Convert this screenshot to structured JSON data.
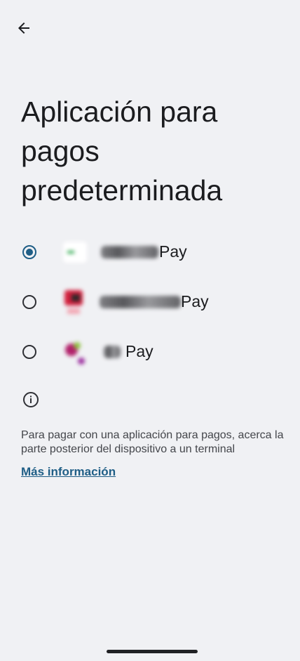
{
  "title": "Aplicación para pagos predeterminada",
  "apps": [
    {
      "pay_label": "Pay",
      "selected": true,
      "icon_colors": [
        "#ffffff",
        "#2fa84f"
      ]
    },
    {
      "pay_label": "Pay",
      "selected": false,
      "icon_colors": [
        "#d21f3c",
        "#f2a7b3"
      ]
    },
    {
      "pay_label": "Pay",
      "selected": false,
      "icon_colors": [
        "#b1206a",
        "#8bbf3a"
      ]
    }
  ],
  "footer": {
    "description": "Para pagar con una aplicación para pagos, acerca la parte posterior del dispositivo a un terminal",
    "link": "Más información"
  },
  "colors": {
    "accent": "#1f5e86",
    "background": "#f0f1f4"
  }
}
